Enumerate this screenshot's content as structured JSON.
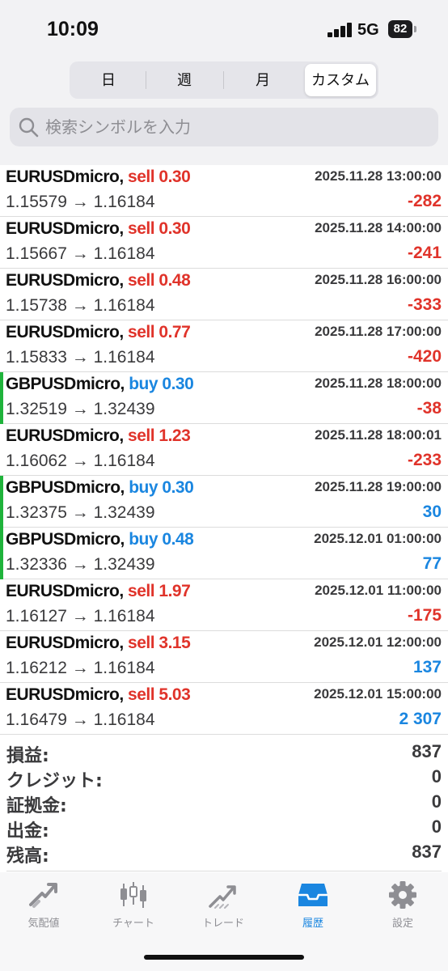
{
  "status": {
    "time": "10:09",
    "network": "5G",
    "battery": "82"
  },
  "segments": [
    {
      "label": "日",
      "active": false
    },
    {
      "label": "週",
      "active": false
    },
    {
      "label": "月",
      "active": false
    },
    {
      "label": "カスタム",
      "active": true
    }
  ],
  "search": {
    "placeholder": "検索シンボルを入力"
  },
  "trades": [
    {
      "symbol": "EURUSDmicro,",
      "side": "sell",
      "volume": "0.30",
      "time": "2025.11.28 13:00:00",
      "open": "1.15579",
      "close": "1.16184",
      "profit": "-282"
    },
    {
      "symbol": "EURUSDmicro,",
      "side": "sell",
      "volume": "0.30",
      "time": "2025.11.28 14:00:00",
      "open": "1.15667",
      "close": "1.16184",
      "profit": "-241"
    },
    {
      "symbol": "EURUSDmicro,",
      "side": "sell",
      "volume": "0.48",
      "time": "2025.11.28 16:00:00",
      "open": "1.15738",
      "close": "1.16184",
      "profit": "-333"
    },
    {
      "symbol": "EURUSDmicro,",
      "side": "sell",
      "volume": "0.77",
      "time": "2025.11.28 17:00:00",
      "open": "1.15833",
      "close": "1.16184",
      "profit": "-420"
    },
    {
      "symbol": "GBPUSDmicro,",
      "side": "buy",
      "volume": "0.30",
      "time": "2025.11.28 18:00:00",
      "open": "1.32519",
      "close": "1.32439",
      "profit": "-38"
    },
    {
      "symbol": "EURUSDmicro,",
      "side": "sell",
      "volume": "1.23",
      "time": "2025.11.28 18:00:01",
      "open": "1.16062",
      "close": "1.16184",
      "profit": "-233"
    },
    {
      "symbol": "GBPUSDmicro,",
      "side": "buy",
      "volume": "0.30",
      "time": "2025.11.28 19:00:00",
      "open": "1.32375",
      "close": "1.32439",
      "profit": "30"
    },
    {
      "symbol": "GBPUSDmicro,",
      "side": "buy",
      "volume": "0.48",
      "time": "2025.12.01 01:00:00",
      "open": "1.32336",
      "close": "1.32439",
      "profit": "77"
    },
    {
      "symbol": "EURUSDmicro,",
      "side": "sell",
      "volume": "1.97",
      "time": "2025.12.01 11:00:00",
      "open": "1.16127",
      "close": "1.16184",
      "profit": "-175"
    },
    {
      "symbol": "EURUSDmicro,",
      "side": "sell",
      "volume": "3.15",
      "time": "2025.12.01 12:00:00",
      "open": "1.16212",
      "close": "1.16184",
      "profit": "137"
    },
    {
      "symbol": "EURUSDmicro,",
      "side": "sell",
      "volume": "5.03",
      "time": "2025.12.01 15:00:00",
      "open": "1.16479",
      "close": "1.16184",
      "profit": "2 307"
    }
  ],
  "arrow": "→",
  "summary": [
    {
      "label": "損益:",
      "value": "837"
    },
    {
      "label": "クレジット:",
      "value": "0"
    },
    {
      "label": "証拠金:",
      "value": "0"
    },
    {
      "label": "出金:",
      "value": "0"
    },
    {
      "label": "残高:",
      "value": "837"
    }
  ],
  "tabs": [
    {
      "label": "気配値",
      "icon": "quotes-icon",
      "active": false
    },
    {
      "label": "チャート",
      "icon": "candlestick-chart-icon",
      "active": false
    },
    {
      "label": "トレード",
      "icon": "trade-icon",
      "active": false
    },
    {
      "label": "履歴",
      "icon": "history-inbox-icon",
      "active": true
    },
    {
      "label": "設定",
      "icon": "gear-icon",
      "active": false
    }
  ],
  "colors": {
    "sell": "#e0332a",
    "buy": "#1a86e0",
    "negative": "#e0332a",
    "positive": "#1a86e0",
    "buy_marker": "#1fb33b",
    "active_tab": "#1a86e0"
  }
}
